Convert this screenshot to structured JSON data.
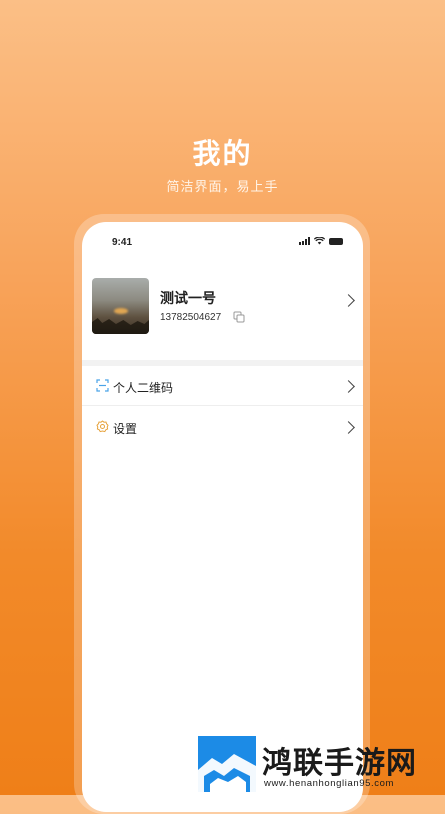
{
  "hero": {
    "title": "我的",
    "subtitle": "简洁界面，易上手"
  },
  "status_bar": {
    "time": "9:41"
  },
  "profile": {
    "name": "测试一号",
    "phone": "13782504627"
  },
  "menu": {
    "items": [
      {
        "label": "个人二维码",
        "icon": "qr-scan-icon"
      },
      {
        "label": "设置",
        "icon": "gear-icon"
      }
    ]
  },
  "watermark": {
    "name": "鸿联手游网",
    "url": "www.henanhonglian95.com"
  },
  "colors": {
    "accent": "#f28a2a",
    "icon_qr": "#4aa3e8",
    "icon_gear": "#e6a23c"
  }
}
